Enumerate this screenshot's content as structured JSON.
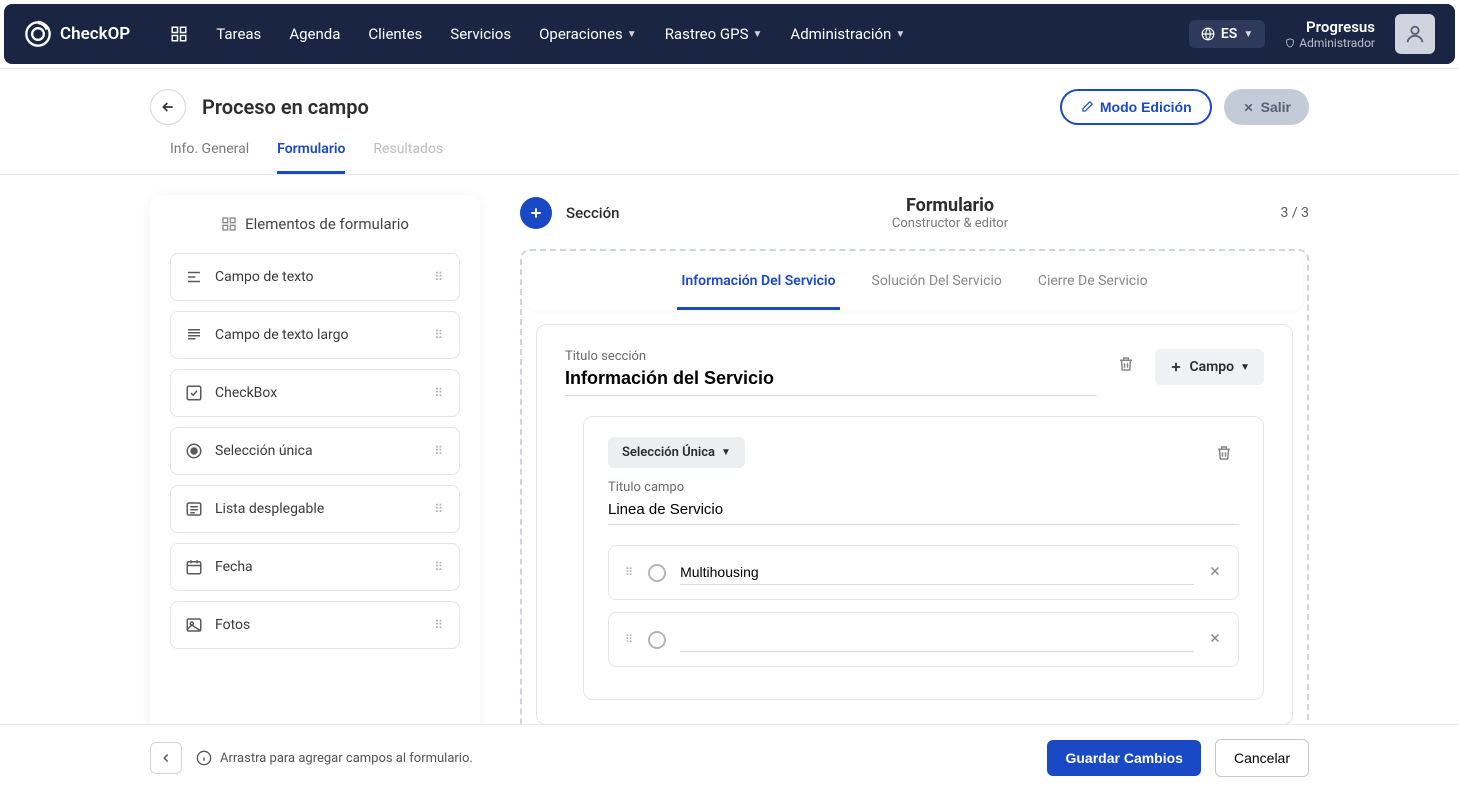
{
  "brand": "CheckOP",
  "nav": {
    "items": [
      "Tareas",
      "Agenda",
      "Clientes",
      "Servicios",
      "Operaciones",
      "Rastreo GPS",
      "Administración"
    ],
    "dropdown_indices": [
      4,
      5,
      6
    ]
  },
  "lang": {
    "label": "ES"
  },
  "user": {
    "name": "Progresus",
    "role": "Administrador"
  },
  "page": {
    "title": "Proceso en campo",
    "tabs": [
      "Info. General",
      "Formulario",
      "Resultados"
    ],
    "active_tab": 1,
    "disabled_tab": 2,
    "edit_btn": "Modo Edición",
    "exit_btn": "Salir"
  },
  "sidebar": {
    "title": "Elementos de formulario",
    "elements": [
      {
        "label": "Campo de texto",
        "icon": "text-line"
      },
      {
        "label": "Campo de texto largo",
        "icon": "text-multi"
      },
      {
        "label": "CheckBox",
        "icon": "check"
      },
      {
        "label": "Selección única",
        "icon": "radio"
      },
      {
        "label": "Lista desplegable",
        "icon": "list"
      },
      {
        "label": "Fecha",
        "icon": "calendar"
      },
      {
        "label": "Fotos",
        "icon": "image"
      }
    ]
  },
  "builder": {
    "add_section": "Sección",
    "title": "Formulario",
    "subtitle": "Constructor & editor",
    "counter": "3 / 3",
    "section_tabs": [
      "Información Del Servicio",
      "Solución Del Servicio",
      "Cierre De Servicio"
    ],
    "active_section_tab": 0,
    "section": {
      "label": "Titulo sección",
      "value": "Información del Servicio",
      "add_field": "Campo"
    },
    "field": {
      "type": "Selección Única",
      "label": "Titulo campo",
      "value": "Linea de Servicio",
      "options": [
        "Multihousing",
        ""
      ]
    }
  },
  "footer": {
    "hint": "Arrastra para agregar campos al formulario.",
    "save": "Guardar Cambios",
    "cancel": "Cancelar"
  }
}
